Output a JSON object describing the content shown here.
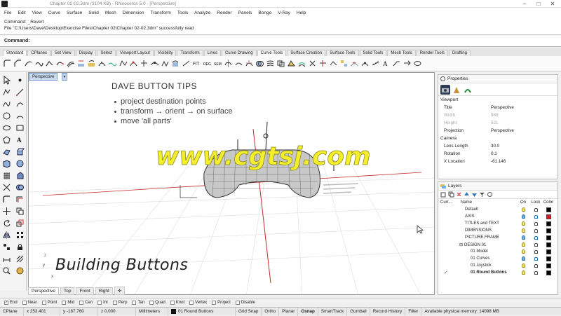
{
  "window": {
    "title": "Chapter 02-02.3dm (3104 KB) - Rhinoceros 5.0 - [Perspective]",
    "controls": [
      "–",
      "□",
      "✕"
    ]
  },
  "menu": [
    "File",
    "Edit",
    "View",
    "Curve",
    "Surface",
    "Solid",
    "Mesh",
    "Dimension",
    "Transform",
    "Tools",
    "Analyze",
    "Render",
    "Panels",
    "Bongo",
    "V-Ray",
    "Help"
  ],
  "command_history": [
    "Command: _Revert",
    "File \"C:\\Users\\Dave\\Desktop\\Exercise Files\\Chapter 02\\Chapter 02-02.3dm\" successfully read"
  ],
  "command_prompt": "Command:",
  "toolbar_tabs": [
    "Standard",
    "CPlanes",
    "Set View",
    "Display",
    "Select",
    "Viewport Layout",
    "Visibility",
    "Transform",
    "Lines",
    "Curve Drawing",
    "Curve Tools",
    "Surface Creation",
    "Surface Tools",
    "Solid Tools",
    "Mesh Tools",
    "Render Tools",
    "Drafting"
  ],
  "active_toolbar_tab": "Curve Tools",
  "viewport": {
    "label": "Perspective",
    "slide_title": "DAVE BUTTON TIPS",
    "bullets": [
      "project destination points",
      "transform → orient → on surface",
      "move 'all parts'"
    ],
    "caption": "Building Buttons",
    "axis_x": "x",
    "axis_z": "z",
    "axis_y": "y"
  },
  "viewport_tabs": [
    "Perspective",
    "Top",
    "Front",
    "Right"
  ],
  "add_tab": "✣",
  "watermark": "www.cgtsj.com",
  "osnaps": [
    {
      "label": "End",
      "checked": true
    },
    {
      "label": "Near",
      "checked": false
    },
    {
      "label": "Point",
      "checked": false
    },
    {
      "label": "Mid",
      "checked": false
    },
    {
      "label": "Cen",
      "checked": false
    },
    {
      "label": "Int",
      "checked": false
    },
    {
      "label": "Perp",
      "checked": false
    },
    {
      "label": "Tan",
      "checked": false
    },
    {
      "label": "Quad",
      "checked": false
    },
    {
      "label": "Knot",
      "checked": false
    },
    {
      "label": "Vertex",
      "checked": false
    },
    {
      "label": "Project",
      "checked": false
    },
    {
      "label": "Disable",
      "checked": false
    }
  ],
  "status": {
    "cplane": "CPlane",
    "x": "x 253.401",
    "y": "y -187.760",
    "z": "z 0.000",
    "units": "Millimeters",
    "layer": "01 Round Buttons",
    "grid_snap": "Grid Snap",
    "ortho": "Ortho",
    "planar": "Planar",
    "osnap": "Osnap",
    "smarttrack": "SmartTrack",
    "gumball": "Gumball",
    "record_history": "Record History",
    "filter": "Filter",
    "memory": "Available physical memory: 14098 MB"
  },
  "properties": {
    "title": "Properties",
    "section_viewport": "Viewport",
    "rows_viewport": [
      {
        "k": "Title",
        "v": "Perspective",
        "dim": false
      },
      {
        "k": "Width",
        "v": "989",
        "dim": true
      },
      {
        "k": "Height",
        "v": "521",
        "dim": true
      },
      {
        "k": "Projection",
        "v": "Perspective",
        "dim": false
      }
    ],
    "section_camera": "Camera",
    "rows_camera": [
      {
        "k": "Lens Length",
        "v": "30.0"
      },
      {
        "k": "Rotation",
        "v": "0.1"
      },
      {
        "k": "X Location",
        "v": "-61.146"
      }
    ]
  },
  "layers": {
    "title": "Layers",
    "headers": {
      "current": "Curr...",
      "name": "Name",
      "on": "On",
      "lock": "Lock",
      "color": "Color"
    },
    "rows": [
      {
        "name": "Default",
        "color": "#000000",
        "blue": false,
        "current": false,
        "indent": 0
      },
      {
        "name": "AXIS",
        "color": "#d42020",
        "blue": true,
        "current": false,
        "indent": 0
      },
      {
        "name": "TITLES and TEXT",
        "color": "#000000",
        "blue": false,
        "current": false,
        "indent": 0
      },
      {
        "name": "DIMENSIONS",
        "color": "#000000",
        "blue": false,
        "current": false,
        "indent": 0
      },
      {
        "name": "PICTURE FRAME",
        "color": "#000000",
        "blue": true,
        "current": false,
        "indent": 0
      },
      {
        "name": "DESIGN 01",
        "color": "#000000",
        "blue": false,
        "current": false,
        "indent": 0,
        "expander": "⊟"
      },
      {
        "name": "01 Model",
        "color": "#000000",
        "blue": false,
        "current": false,
        "indent": 1
      },
      {
        "name": "01 Curves",
        "color": "#000000",
        "blue": true,
        "current": false,
        "indent": 1
      },
      {
        "name": "01 Joystick",
        "color": "#000000",
        "blue": false,
        "current": false,
        "indent": 1
      },
      {
        "name": "01 Round Buttons",
        "color": "#000000",
        "blue": false,
        "current": true,
        "indent": 1
      }
    ]
  }
}
